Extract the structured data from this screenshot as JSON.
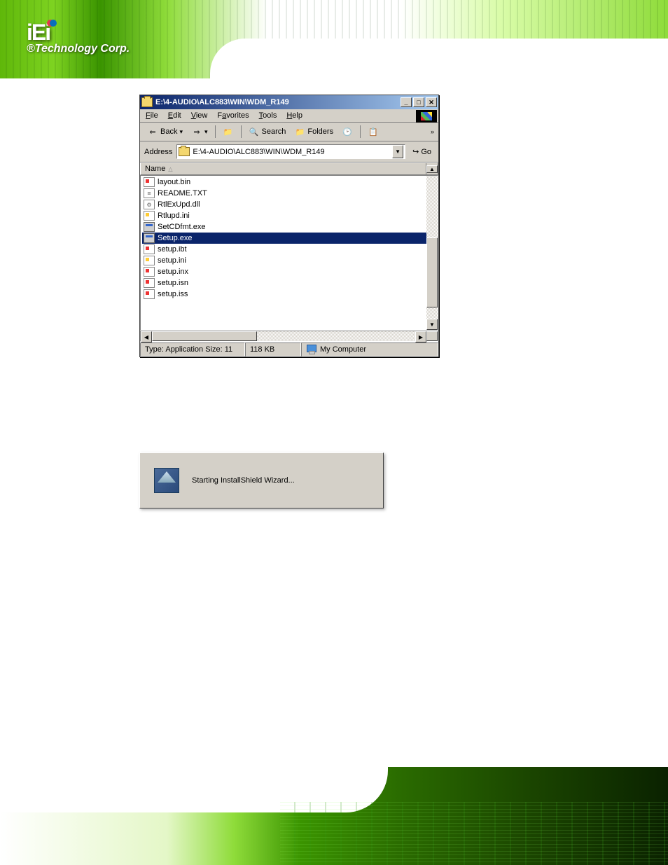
{
  "logo": {
    "brand": "iEi",
    "sub": "®Technology Corp."
  },
  "window": {
    "title": "E:\\4-AUDIO\\ALC883\\WIN\\WDM_R149",
    "menu": {
      "file": "File",
      "edit": "Edit",
      "view": "View",
      "favorites": "Favorites",
      "tools": "Tools",
      "help": "Help"
    },
    "toolbar": {
      "back": "Back",
      "search": "Search",
      "folders": "Folders"
    },
    "address": {
      "label": "Address",
      "path": "E:\\4-AUDIO\\ALC883\\WIN\\WDM_R149",
      "go": "Go"
    },
    "listheader": {
      "name": "Name"
    },
    "files": [
      {
        "name": "layout.bin",
        "icon": "bin"
      },
      {
        "name": "README.TXT",
        "icon": "txt"
      },
      {
        "name": "RtlExUpd.dll",
        "icon": "dll"
      },
      {
        "name": "Rtlupd.ini",
        "icon": "ini"
      },
      {
        "name": "SetCDfmt.exe",
        "icon": "exe"
      },
      {
        "name": "Setup.exe",
        "icon": "exe",
        "selected": true
      },
      {
        "name": "setup.ibt",
        "icon": "bin"
      },
      {
        "name": "setup.ini",
        "icon": "ini"
      },
      {
        "name": "setup.inx",
        "icon": "bin"
      },
      {
        "name": "setup.isn",
        "icon": "bin"
      },
      {
        "name": "setup.iss",
        "icon": "bin"
      }
    ],
    "status": {
      "type": "Type: Application Size: 11",
      "size": "118 KB",
      "location": "My Computer"
    }
  },
  "wizard": {
    "text": "Starting InstallShield Wizard..."
  }
}
